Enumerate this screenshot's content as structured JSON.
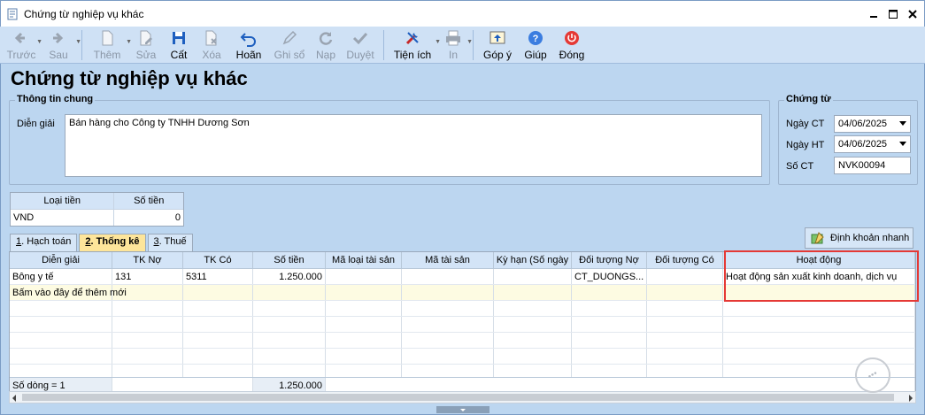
{
  "window": {
    "title": "Chứng từ nghiệp vụ khác"
  },
  "toolbar": [
    {
      "label": "Trước",
      "icon": "arrow-left-icon",
      "disabled": true,
      "dropdown": true
    },
    {
      "label": "Sau",
      "icon": "arrow-right-icon",
      "disabled": true,
      "dropdown": true
    },
    {
      "label": "Thêm",
      "icon": "new-document-icon",
      "disabled": true,
      "dropdown": true
    },
    {
      "label": "Sửa",
      "icon": "edit-document-icon",
      "disabled": true
    },
    {
      "label": "Cất",
      "icon": "save-icon",
      "disabled": false
    },
    {
      "label": "Xóa",
      "icon": "delete-document-icon",
      "disabled": true
    },
    {
      "label": "Hoãn",
      "icon": "undo-icon",
      "disabled": false
    },
    {
      "label": "Ghi sổ",
      "icon": "pencil-icon",
      "disabled": true
    },
    {
      "label": "Nạp",
      "icon": "refresh-icon",
      "disabled": true
    },
    {
      "label": "Duyệt",
      "icon": "check-icon",
      "disabled": true
    },
    {
      "label": "Tiện ích",
      "icon": "tools-icon",
      "disabled": false,
      "dropdown": true
    },
    {
      "label": "In",
      "icon": "printer-icon",
      "disabled": true,
      "dropdown": true
    },
    {
      "label": "Góp ý",
      "icon": "feedback-icon",
      "disabled": false
    },
    {
      "label": "Giúp",
      "icon": "help-icon",
      "disabled": false
    },
    {
      "label": "Đóng",
      "icon": "power-icon",
      "disabled": false
    }
  ],
  "heading": "Chứng từ nghiệp vụ khác",
  "general": {
    "legend": "Thông tin chung",
    "desc_label": "Diễn giải",
    "desc_value": "Bán hàng cho Công ty TNHH Dương Sơn"
  },
  "voucher": {
    "legend": "Chứng từ",
    "date_ct_label": "Ngày CT",
    "date_ct_value": "04/06/2025",
    "date_ht_label": "Ngày HT",
    "date_ht_value": "04/06/2025",
    "so_ct_label": "Số CT",
    "so_ct_value": "NVK00094"
  },
  "currency": {
    "headers": [
      "Loại tiền",
      "Số tiền"
    ],
    "row": [
      "VND",
      "0"
    ]
  },
  "tabs": [
    {
      "key": "1",
      "label": ". Hạch toán",
      "active": false
    },
    {
      "key": "2",
      "label": ". Thống kê",
      "active": true
    },
    {
      "key": "3",
      "label": ". Thuế",
      "active": false
    }
  ],
  "quick_button": "Định khoản nhanh",
  "grid": {
    "headers": [
      "Diễn giải",
      "TK Nợ",
      "TK Có",
      "Số tiền",
      "Mã loại tài sản",
      "Mã tài sản",
      "Kỳ hạn (Số ngày",
      "Đối tượng Nợ",
      "Đối tượng Có",
      "Hoạt động"
    ],
    "rows": [
      [
        "Bông y tế",
        "131",
        "5311",
        "1.250.000",
        "",
        "",
        "",
        "CT_DUONGS...",
        "",
        "Hoạt động sản xuất kinh doanh, dịch vụ"
      ]
    ],
    "add_row_text": "Bấm vào đây để thêm mới",
    "footer_count": "Số dòng = 1",
    "footer_total": "1.250.000"
  },
  "accent": "#e53935"
}
